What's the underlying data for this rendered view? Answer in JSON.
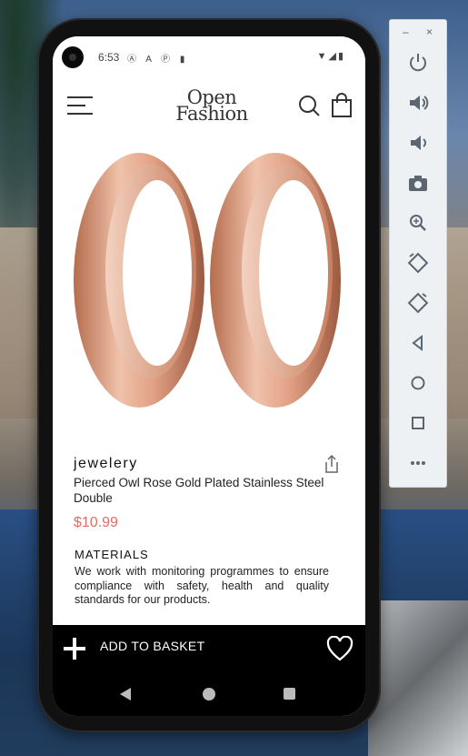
{
  "status_bar": {
    "time": "6:53",
    "notification_icons": "Ⓐ A Ⓟ ▮",
    "system_icons": "▼◢▮"
  },
  "header": {
    "logo_line1": "Open",
    "logo_line2": "Fashion"
  },
  "product": {
    "category": "jewelery",
    "title": "Pierced Owl Rose Gold Plated Stainless Steel Double",
    "price": "$10.99",
    "materials_heading": "MATERIALS",
    "materials_text": "We work with monitoring programmes to ensure compliance with safety, health and quality standards for our products."
  },
  "bottom_bar": {
    "add_to_basket_label": "ADD TO BASKET"
  },
  "emulator_toolbar": {
    "window_controls": [
      "–",
      "×"
    ],
    "tools": [
      "power-icon",
      "volume-up-icon",
      "volume-down-icon",
      "camera-icon",
      "zoom-icon",
      "rotate-left-icon",
      "rotate-right-icon",
      "back-icon",
      "home-icon",
      "overview-icon",
      "more-icon"
    ]
  },
  "colors": {
    "price": "#e46d62",
    "ring": "#d9987c",
    "bottom_bar": "#000000"
  }
}
